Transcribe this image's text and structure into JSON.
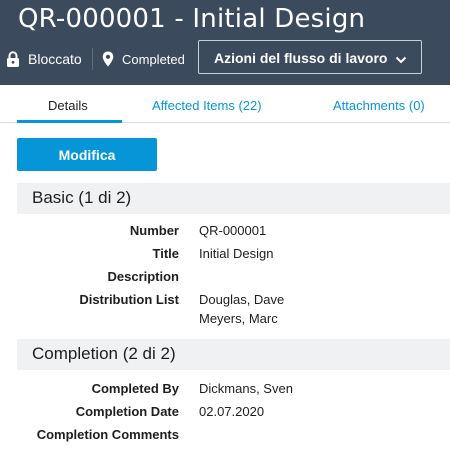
{
  "header": {
    "title": "QR-000001 - Initial Design",
    "lock_status": "Bloccato",
    "workflow_state": "Completed",
    "workflow_actions_label": "Azioni del flusso di lavoro",
    "icons": {
      "lock": "lock-icon",
      "state": "location-pin-icon",
      "dropdown": "chevron-down-icon"
    }
  },
  "tabs": [
    {
      "label": "Details",
      "selected": true
    },
    {
      "label": "Affected Items (22)",
      "selected": false
    },
    {
      "label": "Attachments (0)",
      "selected": false
    }
  ],
  "actions": {
    "edit_label": "Modifica"
  },
  "sections": [
    {
      "title": "Basic (1 di 2)",
      "fields": [
        {
          "label": "Number",
          "value": "QR-000001"
        },
        {
          "label": "Title",
          "value": "Initial Design"
        },
        {
          "label": "Description",
          "value": ""
        },
        {
          "label": "Distribution List",
          "value": "Douglas, Dave",
          "value_line2": "Meyers, Marc"
        }
      ]
    },
    {
      "title": "Completion (2 di 2)",
      "fields": [
        {
          "label": "Completed By",
          "value": "Dickmans, Sven"
        },
        {
          "label": "Completion Date",
          "value": "02.07.2020"
        },
        {
          "label": "Completion Comments",
          "value": ""
        }
      ]
    }
  ],
  "colors": {
    "header_bg": "#3c4a5e",
    "accent": "#0696d7",
    "section_bg": "#f0f1f3"
  }
}
